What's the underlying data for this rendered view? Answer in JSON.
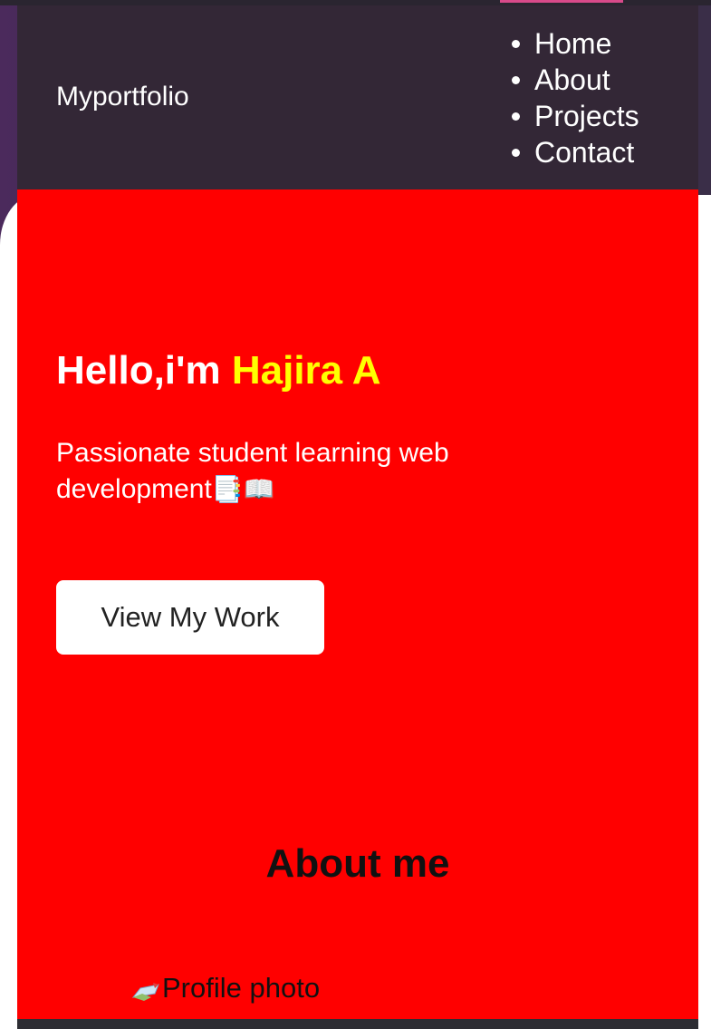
{
  "nav": {
    "brand": "Myportfolio",
    "items": [
      {
        "label": "Home"
      },
      {
        "label": "About"
      },
      {
        "label": "Projects"
      },
      {
        "label": "Contact"
      }
    ]
  },
  "hero": {
    "greeting": "Hello,i'm ",
    "name": "Hajira A",
    "tagline": "Passionate student learning web development",
    "tagline_emoji": "📑📖",
    "cta_label": "View My Work"
  },
  "about": {
    "title": "About me",
    "profile_alt": "Profile photo"
  },
  "colors": {
    "hero_bg": "#ff0000",
    "nav_bg": "#332736",
    "name_highlight": "#ffff00"
  },
  "icons": {
    "broken_image": "broken-image-icon"
  }
}
